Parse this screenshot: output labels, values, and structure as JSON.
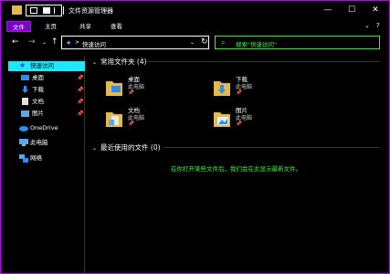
{
  "window": {
    "title": "文件资源管理器",
    "accent": "#c000ff"
  },
  "controls": {
    "minimize": "—",
    "maximize": "☐",
    "close": "✕"
  },
  "ribbon": {
    "tabs": [
      "文件",
      "主页",
      "共享",
      "查看"
    ],
    "expand": "⌄",
    "help": "?"
  },
  "address": {
    "back": "←",
    "forward": "→",
    "dropdown": "⌄",
    "up": "↑",
    "chevron": ">",
    "path": "快速访问",
    "refresh": "↻",
    "search_placeholder": "搜索\"快速访问\""
  },
  "nav": {
    "quick_access": "快速访问",
    "items": [
      {
        "label": "桌面",
        "pinned": true
      },
      {
        "label": "下载",
        "pinned": true
      },
      {
        "label": "文档",
        "pinned": true
      },
      {
        "label": "图片",
        "pinned": true
      }
    ],
    "onedrive": "OneDrive",
    "this_pc": "此电脑",
    "network": "网络"
  },
  "main": {
    "frequent_header": "常用文件夹 (4)",
    "recent_header": "最近使用的文件 (0)",
    "folders": [
      {
        "name": "桌面",
        "location": "此电脑"
      },
      {
        "name": "下载",
        "location": "此电脑"
      },
      {
        "name": "文档",
        "location": "此电脑"
      },
      {
        "name": "图片",
        "location": "此电脑"
      }
    ],
    "empty_message": "在你打开某些文件后，我们会在此显示最新文件。"
  },
  "colors": {
    "highlight_cyan": "#1ae9ff",
    "text_green": "#3ff23f",
    "folder_yellow": "#e7b84b"
  }
}
